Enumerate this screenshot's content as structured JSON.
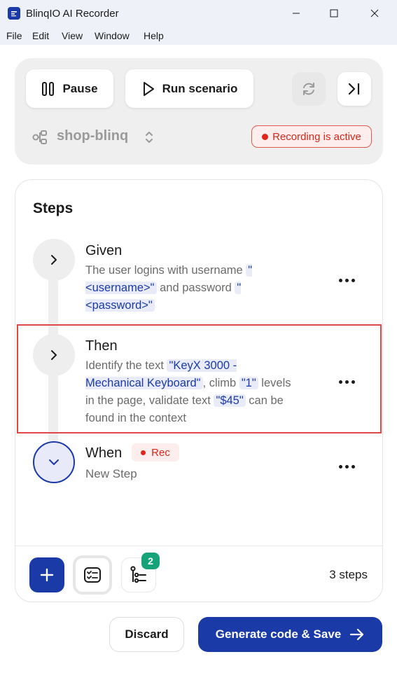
{
  "window": {
    "title": "BlinqIO AI Recorder"
  },
  "menu": {
    "items": [
      "File",
      "Edit",
      "View",
      "Window",
      "Help"
    ]
  },
  "controls": {
    "pause_label": "Pause",
    "run_label": "Run scenario",
    "project_name": "shop-blinq",
    "recording_status": "Recording is active"
  },
  "steps": {
    "title": "Steps",
    "items": [
      {
        "keyword": "Given",
        "desc": [
          "The user logins with username ",
          "\"<username>\"",
          " and password ",
          "\"<password>\""
        ]
      },
      {
        "keyword": "Then",
        "desc": [
          "Identify the text ",
          "\"KeyX 3000 - Mechanical Keyboard\"",
          ", climb ",
          "\"1\"",
          " levels in the page, validate text ",
          "\"$45\"",
          " can be found in the context"
        ]
      },
      {
        "keyword": "When",
        "rec_label": "Rec",
        "desc": "New Step"
      }
    ],
    "count_label": "3 steps",
    "tree_badge": "2"
  },
  "footer": {
    "discard_label": "Discard",
    "generate_label": "Generate code & Save"
  },
  "colors": {
    "accent": "#1a3aa8",
    "recording_red": "#d3281c",
    "badge_green": "#16a37a"
  }
}
